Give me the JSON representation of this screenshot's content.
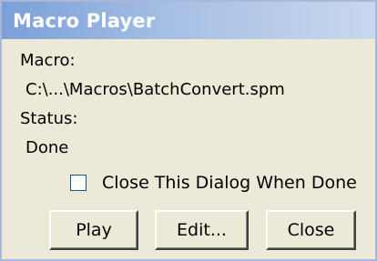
{
  "window": {
    "title": "Macro Player"
  },
  "macro": {
    "label": "Macro:",
    "path": "C:\\...\\Macros\\BatchConvert.spm"
  },
  "status": {
    "label": "Status:",
    "value": "Done"
  },
  "options": {
    "close_when_done_label": "Close This Dialog When Done",
    "close_when_done_checked": false
  },
  "buttons": {
    "play": "Play",
    "edit": "Edit...",
    "close": "Close"
  }
}
